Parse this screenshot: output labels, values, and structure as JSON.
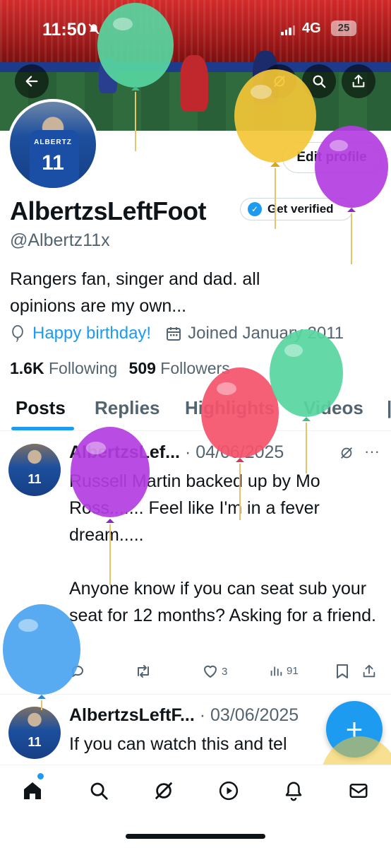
{
  "status_bar": {
    "time": "11:50",
    "network": "4G",
    "battery": "25"
  },
  "profile": {
    "display_name": "AlbertzsLeftFoot",
    "handle": "@Albertz11x",
    "avatar_number": "11",
    "avatar_name": "ALBERTZ",
    "edit_profile_label": "Edit profile",
    "get_verified_label": "Get verified",
    "bio_line1": "Rangers fan, singer and dad. all",
    "bio_line2": "opinions are my own...",
    "birthday_text": "Happy birthday!",
    "joined_text": "Joined January 2011",
    "following_count": "1.6K",
    "following_label": "Following",
    "followers_count": "509",
    "followers_label": "Followers"
  },
  "tabs": [
    "Posts",
    "Replies",
    "Highlights",
    "Videos"
  ],
  "posts": [
    {
      "author": "AlbertzsLef...",
      "date": "04/06/2025",
      "text": "Russell Martin backed up by Mo Ross....... Feel like I'm in a fever dream.....\n\nAnyone know if you can seat sub your seat for 12 months? Asking for a friend.",
      "likes": "3",
      "views": "91"
    },
    {
      "author": "AlbertzsLeftF...",
      "date": "03/06/2025",
      "text": "If you can watch this and tel"
    }
  ],
  "fab_label": "+",
  "icons": {
    "back": "arrow-left-icon",
    "search": "search-icon",
    "share": "share-icon",
    "home": "home-icon",
    "explore": "search-icon",
    "grok": "grok-icon",
    "video": "play-icon",
    "notifications": "bell-icon",
    "messages": "mail-icon"
  },
  "colors": {
    "accent": "#1d9bf0",
    "text": "#0f1419",
    "muted": "#536471"
  },
  "balloon_colors": [
    "#57d6a0",
    "#f3c636",
    "#b33de0",
    "#f4526b",
    "#57d6a0",
    "#b33de0",
    "#4aa3f0",
    "#f3c636"
  ]
}
